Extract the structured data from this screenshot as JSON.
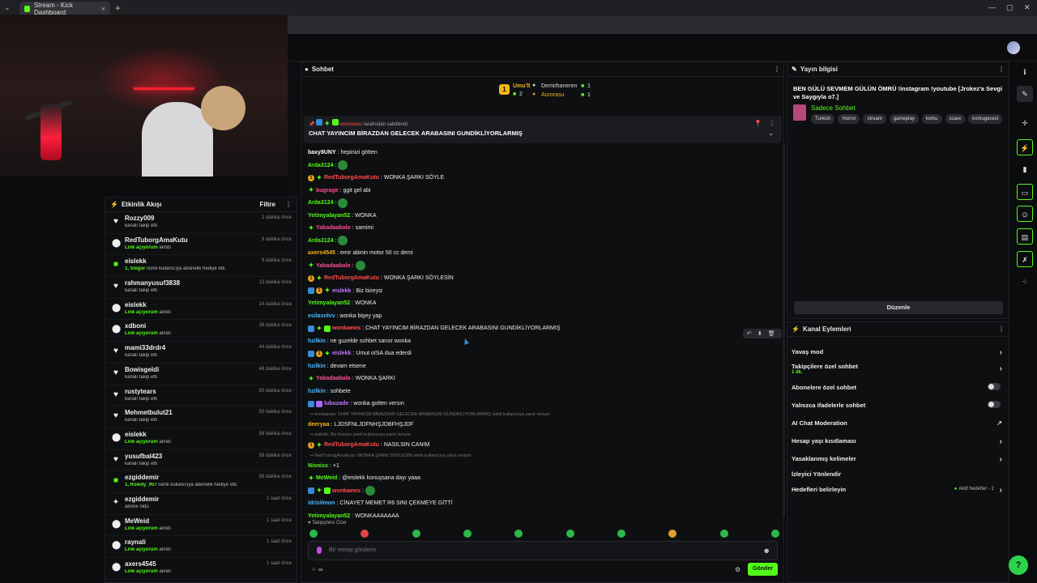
{
  "browser": {
    "tab_title": "Stream - Kick Dashboard",
    "new_tab": "+",
    "tab_close": "×"
  },
  "activity": {
    "title": "Etkinlik Akışı",
    "filter": "Filtre",
    "items": [
      {
        "icon": "heart-icon",
        "glyph": "♥",
        "name": "Rozzy009",
        "desc": "kanalı takip etti",
        "hl": "",
        "time": "2 dakika önce"
      },
      {
        "icon": "kick-icon",
        "glyph": "⬤",
        "name": "RedTuborgAmaKutu",
        "desc": "alındı",
        "hl": "Link açıyorum",
        "time": "9 dakika önce"
      },
      {
        "icon": "gift-icon",
        "glyph": "■",
        "name": "eislekk",
        "desc": "isimli kullanıcıya abonelik hediye etti.",
        "hl": "1, Slegor",
        "time": "9 dakika önce"
      },
      {
        "icon": "heart-icon",
        "glyph": "♥",
        "name": "rahmanyusuf3838",
        "desc": "kanalı takip etti",
        "hl": "",
        "time": "13 dakika önce"
      },
      {
        "icon": "kick-icon",
        "glyph": "⬤",
        "name": "eislekk",
        "desc": "alındı",
        "hl": "Link açıyorum",
        "time": "14 dakika önce"
      },
      {
        "icon": "kick-icon",
        "glyph": "⬤",
        "name": "xdboni",
        "desc": "alındı",
        "hl": "Link açıyorum",
        "time": "38 dakika önce"
      },
      {
        "icon": "heart-icon",
        "glyph": "♥",
        "name": "mami33drdr4",
        "desc": "kanalı takip etti",
        "hl": "",
        "time": "44 dakika önce"
      },
      {
        "icon": "heart-icon",
        "glyph": "♥",
        "name": "Bowisgeldi",
        "desc": "kanalı takip etti",
        "hl": "",
        "time": "48 dakika önce"
      },
      {
        "icon": "heart-icon",
        "glyph": "♥",
        "name": "rustytears",
        "desc": "kanalı takip etti",
        "hl": "",
        "time": "50 dakika önce"
      },
      {
        "icon": "heart-icon",
        "glyph": "♥",
        "name": "Mehmetbulut21",
        "desc": "kanalı takip etti",
        "hl": "",
        "time": "50 dakika önce"
      },
      {
        "icon": "kick-icon",
        "glyph": "⬤",
        "name": "eislekk",
        "desc": "alındı",
        "hl": "Link açıyorum",
        "time": "58 dakika önce"
      },
      {
        "icon": "heart-icon",
        "glyph": "♥",
        "name": "yusufbal423",
        "desc": "kanalı takip etti",
        "hl": "",
        "time": "58 dakika önce"
      },
      {
        "icon": "gift-icon",
        "glyph": "■",
        "name": "ezgiddemir",
        "desc": "isimli kullanıcıya abonelik hediye etti.",
        "hl": "1, Rowdy_957",
        "time": "58 dakika önce"
      },
      {
        "icon": "sparkle-icon",
        "glyph": "✦",
        "name": "ezgiddemir",
        "desc": "abone oldu",
        "hl": "",
        "time": "1 saat önce"
      },
      {
        "icon": "kick-icon",
        "glyph": "⬤",
        "name": "MeWeid",
        "desc": "alındı",
        "hl": "Link açıyorum",
        "time": "1 saat önce"
      },
      {
        "icon": "kick-icon",
        "glyph": "⬤",
        "name": "raynali",
        "desc": "alındı",
        "hl": "Link açıyorum",
        "time": "1 saat önce"
      },
      {
        "icon": "kick-icon",
        "glyph": "⬤",
        "name": "axers4545",
        "desc": "alındı",
        "hl": "Link açıyorum",
        "time": "1 saat önce"
      }
    ]
  },
  "chat": {
    "title": "Sohbet",
    "leaderboard": {
      "first_rank": "1",
      "first_name": "Umu'lt",
      "first_count": "2",
      "second_name": "Demirhaneren",
      "second_count": "1",
      "third_name": "Aurorasu",
      "third_count": "1"
    },
    "pinned": {
      "by": "tarafından sabitlendi",
      "text": "CHAT YAYINCIM BİRAZDAN GELECEK ARABASINI GUNDİKLİYORLARMIŞ"
    },
    "messages": [
      {
        "badges": [],
        "user": "baxy8UNY",
        "color": "#ffffff",
        "text": "hepinizi götten"
      },
      {
        "badges": [],
        "user": "Arda3124",
        "color": "#53fc18",
        "text": "",
        "emote": true
      },
      {
        "badges": [
          "gold",
          "star"
        ],
        "user": "RedTuborgAmaKutu",
        "color": "#ff4d4d",
        "text": "WONKA ŞARKI SÖYLE"
      },
      {
        "badges": [
          "star"
        ],
        "user": "bugrage",
        "color": "#ff4d8f",
        "text": "ggit gel abi"
      },
      {
        "badges": [],
        "user": "Arda3124",
        "color": "#53fc18",
        "text": "",
        "emote": true
      },
      {
        "badges": [],
        "user": "Yetimyalayan52",
        "color": "#53fc18",
        "text": "WONKA"
      },
      {
        "badges": [
          "star"
        ],
        "user": "Yabadaabalo",
        "color": "#ff4d8f",
        "text": "samimi"
      },
      {
        "badges": [],
        "user": "Arda3124",
        "color": "#53fc18",
        "text": "",
        "emote": true
      },
      {
        "badges": [],
        "user": "axers4545",
        "color": "#f3b51a",
        "text": "emir abinin motor 50 cc demi"
      },
      {
        "badges": [
          "star"
        ],
        "user": "Yabadaabalo",
        "color": "#ff4d8f",
        "text": "",
        "emote": true
      },
      {
        "badges": [
          "gold",
          "star"
        ],
        "user": "RedTuborgAmaKutu",
        "color": "#ff4d4d",
        "text": "WONKA ŞARKI SÖYLESİN"
      },
      {
        "badges": [
          "blue",
          "gold",
          "star"
        ],
        "user": "eislekk",
        "color": "#c377ff",
        "text": "Biz bizeyiz"
      },
      {
        "badges": [],
        "user": "Yetimyalayan52",
        "color": "#53fc18",
        "text": "WONKA"
      },
      {
        "badges": [],
        "user": "esilasnlvv",
        "color": "#4db8ff",
        "text": "wonka bişey yap"
      },
      {
        "badges": [
          "blue",
          "star",
          "green"
        ],
        "user": "wonkaews",
        "color": "#ff4d4d",
        "text": "CHAT YAYINCIM BİRAZDAN GELECEK ARABASINI GUNDİKLİYORLARMIŞ"
      },
      {
        "badges": [],
        "user": "hzilkin",
        "color": "#4db8ff",
        "text": "ne guzelde sohbet sarıor wonka"
      },
      {
        "badges": [
          "blue",
          "gold",
          "star"
        ],
        "user": "eislekk",
        "color": "#c377ff",
        "text": "Umut oISA dua ederdi"
      },
      {
        "badges": [],
        "user": "hzilkin",
        "color": "#4db8ff",
        "text": "devam etsene"
      },
      {
        "badges": [
          "star"
        ],
        "user": "Yabadaabalo",
        "color": "#ff4d8f",
        "text": "WONKA ŞARKI"
      },
      {
        "badges": [],
        "user": "hzilkin",
        "color": "#4db8ff",
        "text": "sohbete"
      },
      {
        "badges": [
          "blue",
          "purple"
        ],
        "user": "lubuzade",
        "color": "#c377ff",
        "text": "wonka gotten versın"
      },
      {
        "reply": "↪ wonkaews: CHAT YAYINCIM BİRAZDAN GELECEK ARABASINI GUNDİKLİYORLARMIŞ isimli kullanıcıya yanıt veriyor"
      },
      {
        "badges": [],
        "user": "deeryaa",
        "color": "#f3b51a",
        "text": "LJDSFNLJDFNHŞJDBFHŞJDF"
      },
      {
        "reply": "↪ eislekk: Biz bizeyiz isimli kullanıcıya yanıt veriyor"
      },
      {
        "badges": [
          "gold",
          "star"
        ],
        "user": "RedTuborgAmaKutu",
        "color": "#ff4d4d",
        "text": "NASILSIN CANIM"
      },
      {
        "reply": "↪ RedTuborgAmaKutu: WONKA ŞARKI SÖYLESİN isimli kullanıcıya yanıt veriyor"
      },
      {
        "badges": [],
        "user": "Nisniss",
        "color": "#53fc18",
        "text": "+1"
      },
      {
        "badges": [
          "star"
        ],
        "user": "MeWeid",
        "color": "#53fc18",
        "text": "@eislekk konuşsana dayı yaaa"
      },
      {
        "badges": [
          "blue",
          "star",
          "green"
        ],
        "user": "wonkaews",
        "color": "#ff4d4d",
        "text": "",
        "emote": true
      },
      {
        "badges": [],
        "user": "idrisilmon",
        "color": "#4db8ff",
        "text": "CİNAYET MEMET R6 SINI ÇEKMEYE GİTTİ"
      },
      {
        "badges": [],
        "user": "Yetimyalayan52",
        "color": "#53fc18",
        "text": "WONKAAAAAAA"
      }
    ],
    "followers_only": "♥ Takipçilere Özel",
    "placeholder": "Bir mesaj gönderin",
    "send": "Gönder",
    "footer_left": "⁘ ∞"
  },
  "stream_info": {
    "title": "Yayın bilgisi",
    "stream_title": "BEN GÜLÜ SEVMEM GÜLÜN ÖMRÜ !instagram !youtube [Jrokez'a Sevgi ve Saygıyla o7.]",
    "category": "Sadece Sohbet",
    "tags": [
      "Turkish",
      "Horror",
      "stream",
      "gameplay",
      "korku",
      "scare",
      "korkugecesi"
    ],
    "edit": "Düzenle"
  },
  "channel_actions": {
    "title": "Kanal Eylemleri",
    "slow_mode": "Yavaş mod",
    "followers_chat": "Takipçilere özel sohbet",
    "followers_chat_sub": "1 dk.",
    "subs_chat": "Abonelere özel sohbet",
    "emotes_chat": "Yalnızca ifadelerle sohbet",
    "ai_mod": "AI Chat Moderation",
    "age_limit": "Hesap yaşı kısıtlaması",
    "banned_words": "Yasaklanmış kelimeler",
    "viewer_redirect": "İzleyici Yönlendir",
    "set_goals": "Hedefleri belirleyin",
    "active_goals": "Aktif hedefler - 2"
  },
  "colors": {
    "accent": "#53fc18",
    "panel": "#0e0f11"
  }
}
